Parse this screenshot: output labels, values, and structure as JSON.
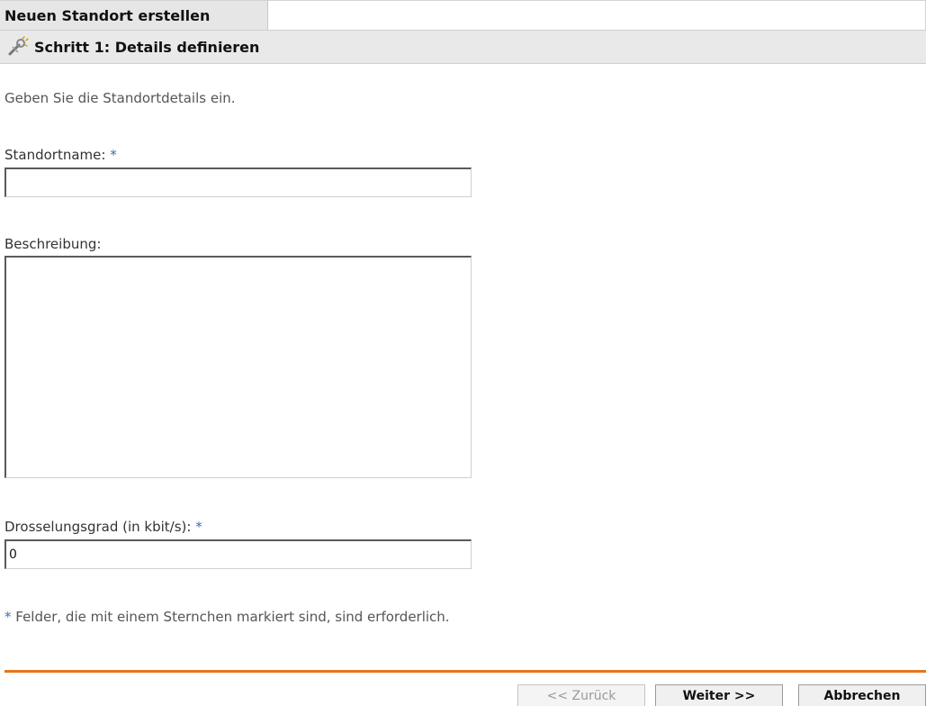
{
  "header": {
    "title": "Neuen Standort erstellen",
    "step_title": "Schritt 1: Details definieren",
    "step_icon": "wrench-wand-icon"
  },
  "form": {
    "intro": "Geben Sie die Standortdetails ein.",
    "required_marker": "*",
    "name_label": "Standortname: ",
    "name_value": "",
    "description_label": "Beschreibung:",
    "description_value": "",
    "throttle_label": "Drosselungsgrad (in kbit/s): ",
    "throttle_value": "0",
    "footnote": " Felder, die mit einem Sternchen markiert sind, sind erforderlich."
  },
  "buttons": {
    "back_label": "<< Zurück",
    "back_enabled": false,
    "next_label": "Weiter >>",
    "cancel_label": "Abbrechen"
  },
  "colors": {
    "accent_divider": "#e4761b",
    "required_marker": "#3a6fb0"
  }
}
